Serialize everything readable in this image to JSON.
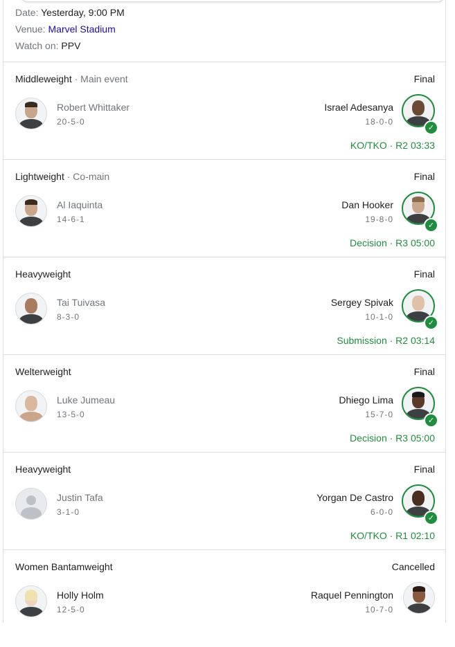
{
  "event": {
    "date_label": "Date:",
    "date_value": "Yesterday, 9:00 PM",
    "venue_label": "Venue:",
    "venue_value": "Marvel Stadium",
    "watch_label": "Watch on:",
    "watch_value": "PPV"
  },
  "fights": [
    {
      "weight": "Middleweight",
      "sub": "Main event",
      "status": "Final",
      "left": {
        "name": "Robert Whittaker",
        "record": "20-5-0"
      },
      "right": {
        "name": "Israel Adesanya",
        "record": "18-0-0"
      },
      "result": "KO/TKO · R2 03:33",
      "winner_icon": "checkmark-icon"
    },
    {
      "weight": "Lightweight",
      "sub": "Co-main",
      "status": "Final",
      "left": {
        "name": "Al Iaquinta",
        "record": "14-6-1"
      },
      "right": {
        "name": "Dan Hooker",
        "record": "19-8-0"
      },
      "result": "Decision · R3 05:00",
      "winner_icon": "checkmark-icon"
    },
    {
      "weight": "Heavyweight",
      "sub": "",
      "status": "Final",
      "left": {
        "name": "Tai Tuivasa",
        "record": "8-3-0"
      },
      "right": {
        "name": "Sergey Spivak",
        "record": "10-1-0"
      },
      "result": "Submission · R2 03:14",
      "winner_icon": "checkmark-icon"
    },
    {
      "weight": "Welterweight",
      "sub": "",
      "status": "Final",
      "left": {
        "name": "Luke Jumeau",
        "record": "13-5-0"
      },
      "right": {
        "name": "Dhiego Lima",
        "record": "15-7-0"
      },
      "result": "Decision · R3 05:00",
      "winner_icon": "checkmark-icon"
    },
    {
      "weight": "Heavyweight",
      "sub": "",
      "status": "Final",
      "left": {
        "name": "Justin Tafa",
        "record": "3-1-0"
      },
      "right": {
        "name": "Yorgan De Castro",
        "record": "6-0-0"
      },
      "result": "KO/TKO · R1 02:10",
      "winner_icon": "checkmark-icon"
    },
    {
      "weight": "Women Bantamweight",
      "sub": "",
      "status": "Cancelled",
      "left": {
        "name": "Holly Holm",
        "record": "12-5-0"
      },
      "right": {
        "name": "Raquel Pennington",
        "record": "10-7-0"
      },
      "result": "",
      "winner_icon": ""
    }
  ],
  "colors": {
    "win_green": "#1e8e3e",
    "link_blue": "#1a0dab",
    "muted": "#70757a",
    "divider": "#dadce0"
  }
}
